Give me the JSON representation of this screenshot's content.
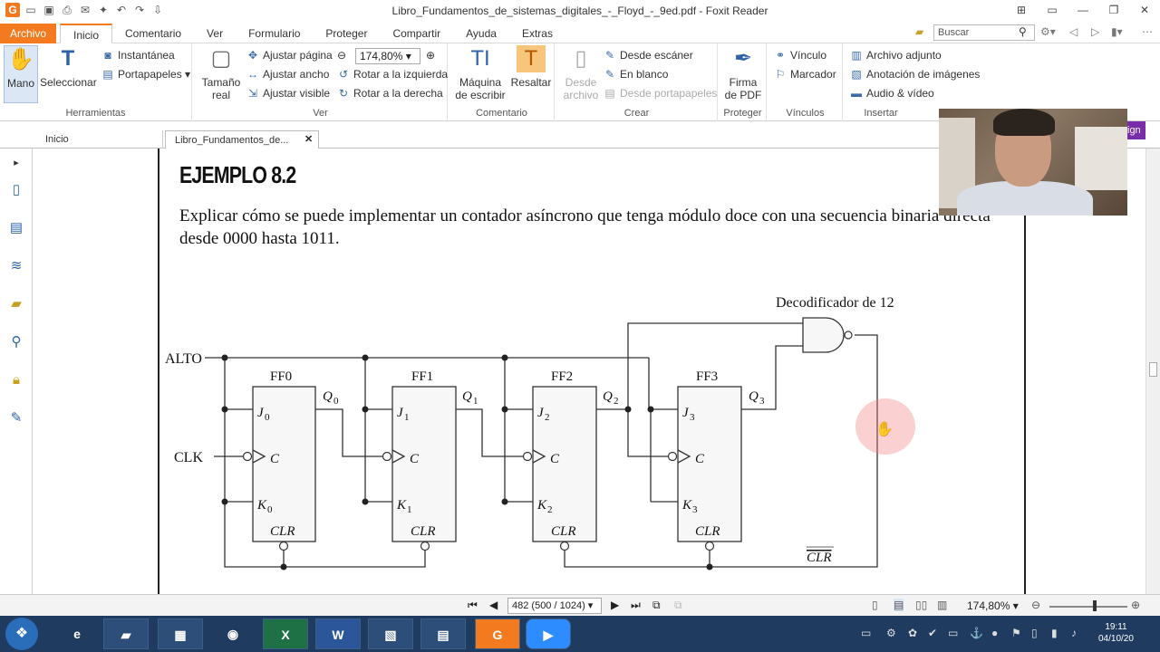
{
  "window": {
    "title": "Libro_Fundamentos_de_sistemas_digitales_-_Floyd_-_9ed.pdf - Foxit Reader",
    "app_icon": "foxit-logo-icon"
  },
  "menu": {
    "archivo": "Archivo",
    "tabs": [
      "Inicio",
      "Comentario",
      "Ver",
      "Formulario",
      "Proteger",
      "Compartir",
      "Ayuda",
      "Extras"
    ],
    "active_tab": "Inicio",
    "search_placeholder": "Buscar"
  },
  "ribbon": {
    "herramientas": {
      "label": "Herramientas",
      "mano": "Mano",
      "seleccionar": "Seleccionar",
      "instantanea": "Instantánea",
      "portapapeles": "Portapapeles"
    },
    "ver": {
      "label": "Ver",
      "tamano_real_1": "Tamaño",
      "tamano_real_2": "real",
      "ajustar_pagina": "Ajustar página",
      "ajustar_ancho": "Ajustar ancho",
      "ajustar_visible": "Ajustar visible",
      "zoom_value": "174,80%",
      "rotar_izq": "Rotar a la izquierda",
      "rotar_der": "Rotar a la derecha"
    },
    "comentario": {
      "label": "Comentario",
      "maquina_1": "Máquina",
      "maquina_2": "de escribir",
      "resaltar": "Resaltar"
    },
    "crear": {
      "label": "Crear",
      "desde_archivo_1": "Desde",
      "desde_archivo_2": "archivo",
      "desde_escaner": "Desde escáner",
      "en_blanco": "En blanco",
      "desde_portapapeles": "Desde portapapeles"
    },
    "proteger": {
      "label": "Proteger",
      "firma_1": "Firma",
      "firma_2": "de PDF"
    },
    "vinculos": {
      "label": "Vínculos",
      "vinculo": "Vínculo",
      "marcador": "Marcador"
    },
    "insertar": {
      "label": "Insertar",
      "archivo_adjunto": "Archivo adjunto",
      "anotacion_imagenes": "Anotación de imágenes",
      "audio_video": "Audio & vídeo"
    }
  },
  "doc_tabs": {
    "home": "Inicio",
    "doc": "Libro_Fundamentos_de..."
  },
  "sign_label": "ign",
  "pdf": {
    "example_title": "EJEMPLO 8.2",
    "example_text": "Explicar cómo se puede implementar un contador asíncrono que tenga módulo doce con una secuencia binaria directa desde 0000 hasta 1011.",
    "circuit": {
      "decoder_label": "Decodificador de 12",
      "alto": "ALTO",
      "clk": "CLK",
      "clr_bar": "CLR",
      "flipflops": [
        {
          "name": "FF0",
          "j": "J",
          "k": "K",
          "sub": "0",
          "c": "C",
          "clr": "CLR",
          "q": "Q",
          "qsub": "0"
        },
        {
          "name": "FF1",
          "j": "J",
          "k": "K",
          "sub": "1",
          "c": "C",
          "clr": "CLR",
          "q": "Q",
          "qsub": "1"
        },
        {
          "name": "FF2",
          "j": "J",
          "k": "K",
          "sub": "2",
          "c": "C",
          "clr": "CLR",
          "q": "Q",
          "qsub": "2"
        },
        {
          "name": "FF3",
          "j": "J",
          "k": "K",
          "sub": "3",
          "c": "C",
          "clr": "CLR",
          "q": "Q",
          "qsub": "3"
        }
      ]
    }
  },
  "status": {
    "page_display": "482 (500 / 1024)",
    "zoom": "174,80%"
  },
  "taskbar": {
    "time": "19:11",
    "date": "04/10/20"
  },
  "colors": {
    "accent": "#f47a20",
    "taskbar": "#1f3b60"
  }
}
